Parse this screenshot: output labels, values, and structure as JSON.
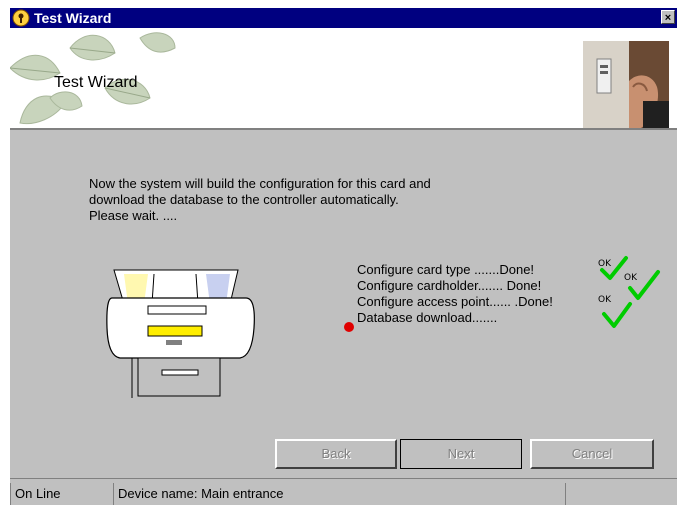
{
  "window": {
    "title": "Test Wizard",
    "close_glyph": "×"
  },
  "banner": {
    "title": "Test Wizard"
  },
  "intro": {
    "line1": "Now the system will build the configuration for this card and",
    "line2": "download the database to the controller automatically.",
    "line3": "Please wait. ...."
  },
  "steps": [
    {
      "label": "Configure card type .......Done!",
      "status": "done"
    },
    {
      "label": "Configure cardholder....... Done!",
      "status": "done"
    },
    {
      "label": "Configure access point...... .Done!",
      "status": "done"
    },
    {
      "label": "Database download.......",
      "status": "in-progress"
    }
  ],
  "check_marks": {
    "label": "OK",
    "color": "#00cc00"
  },
  "buttons": {
    "back": "Back",
    "next": "Next",
    "cancel": "Cancel"
  },
  "statusbar": {
    "connection": "On Line",
    "device": "Device name: Main entrance",
    "extra": ""
  },
  "colors": {
    "titlebar": "#000080",
    "dialog_bg": "#c0c0c0",
    "progress_dot": "#e00000",
    "slot_yellow": "#ffee00"
  }
}
